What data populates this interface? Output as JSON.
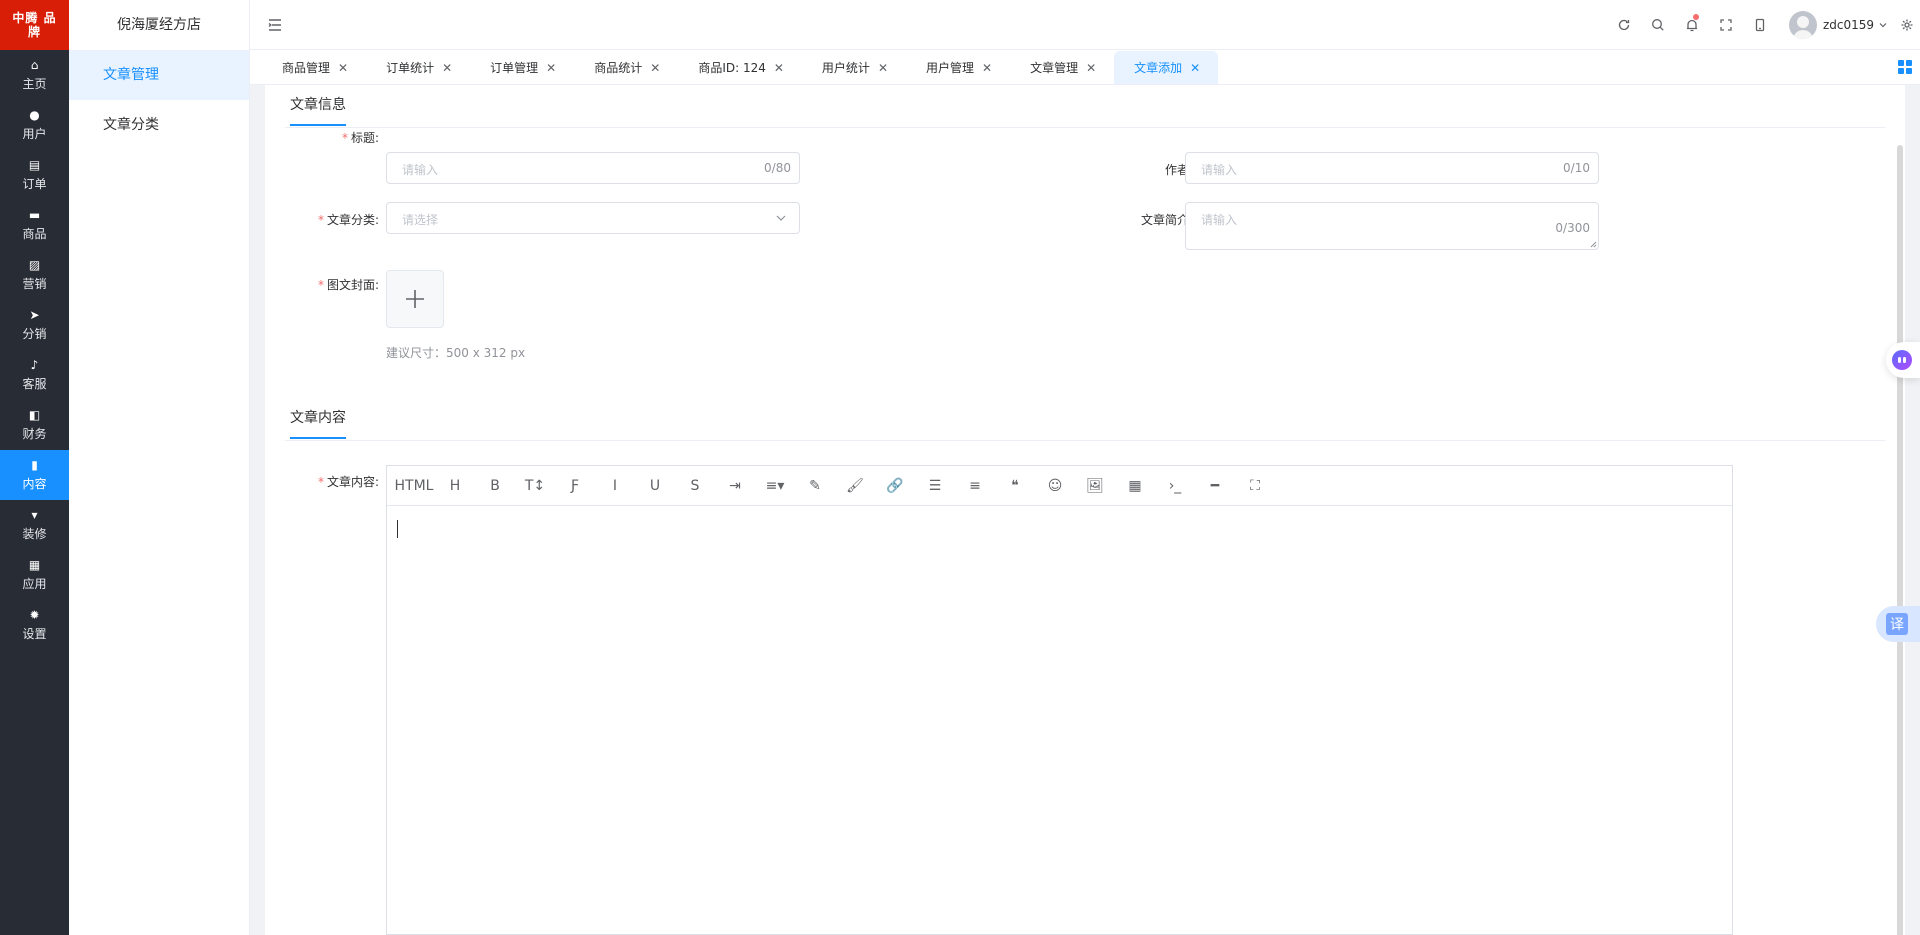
{
  "app": {
    "logo_text": "中腾 品牌",
    "shop_name": "倪海厦经方店"
  },
  "sidebar": {
    "items": [
      {
        "label": "主页",
        "icon": "home-icon"
      },
      {
        "label": "用户",
        "icon": "user-icon"
      },
      {
        "label": "订单",
        "icon": "order-icon"
      },
      {
        "label": "商品",
        "icon": "goods-icon"
      },
      {
        "label": "营销",
        "icon": "marketing-icon"
      },
      {
        "label": "分销",
        "icon": "distribution-icon"
      },
      {
        "label": "客服",
        "icon": "service-icon"
      },
      {
        "label": "财务",
        "icon": "finance-icon"
      },
      {
        "label": "内容",
        "icon": "content-icon",
        "active": true
      },
      {
        "label": "装修",
        "icon": "decorate-icon"
      },
      {
        "label": "应用",
        "icon": "apps-icon"
      },
      {
        "label": "设置",
        "icon": "settings-icon"
      }
    ]
  },
  "submenu": {
    "items": [
      {
        "label": "文章管理",
        "active": true
      },
      {
        "label": "文章分类",
        "active": false
      }
    ]
  },
  "header": {
    "username": "zdc0159",
    "icons": [
      "refresh-icon",
      "search-icon",
      "bell-icon",
      "fullscreen-icon",
      "mobile-icon"
    ]
  },
  "tabs": [
    {
      "label": "商品管理"
    },
    {
      "label": "订单统计"
    },
    {
      "label": "订单管理"
    },
    {
      "label": "商品统计"
    },
    {
      "label": "商品ID: 124"
    },
    {
      "label": "用户统计"
    },
    {
      "label": "用户管理"
    },
    {
      "label": "文章管理"
    },
    {
      "label": "文章添加",
      "active": true
    }
  ],
  "form": {
    "section_info": "文章信息",
    "title_label": "标题:",
    "title_placeholder": "请输入",
    "title_count": "0/80",
    "author_label": "作者:",
    "author_placeholder": "请输入",
    "author_count": "0/10",
    "category_label": "文章分类:",
    "category_placeholder": "请选择",
    "summary_label": "文章简介:",
    "summary_placeholder": "请输入",
    "summary_count": "0/300",
    "cover_label": "图文封面:",
    "cover_hint": "建议尺寸：500 x 312 px",
    "section_content": "文章内容",
    "content_label": "文章内容:"
  },
  "editor": {
    "toolbar": [
      "HTML",
      "H",
      "B",
      "T↕",
      "Ƒ",
      "I",
      "U",
      "S",
      "⇥",
      "≡▾",
      "✎",
      "🖌",
      "🔗",
      "☰",
      "≡",
      "❝",
      "☺",
      "🖼",
      "▦",
      "›_",
      "━",
      "⛶"
    ]
  },
  "floaters": {
    "translate_label": "译"
  },
  "colors": {
    "sidebar_bg": "#282c34",
    "accent": "#1890ff",
    "logo_bg": "#d81e06",
    "required": "#f56c6c"
  }
}
